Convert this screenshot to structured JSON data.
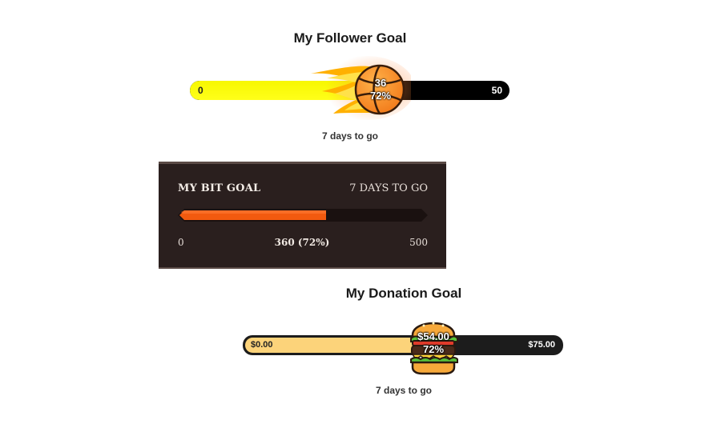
{
  "follower_goal": {
    "title": "My Follower Goal",
    "min": "0",
    "max": "50",
    "current": "36",
    "percent": "72%",
    "progress_fraction": 0.72,
    "days_left": "7 days to go",
    "icon": "basketball-icon"
  },
  "bit_goal": {
    "title": "MY BIT GOAL",
    "days_left": "7 DAYS TO GO",
    "min": "0",
    "progress_label": "360 (72%)",
    "max": "500",
    "progress_fraction": 0.72
  },
  "donation_goal": {
    "title": "My Donation Goal",
    "min": "$0.00",
    "max": "$75.00",
    "current": "$54.00",
    "percent": "72%",
    "progress_fraction": 0.72,
    "days_left": "7 days to go",
    "icon": "burger-icon"
  },
  "colors": {
    "follower_fill": "#f7f700",
    "follower_track": "#000000",
    "bit_panel": "#2a1f1e",
    "bit_fill": "#f25a0f",
    "donation_fill": "#fcd37a",
    "donation_track": "#1c1c1c"
  }
}
